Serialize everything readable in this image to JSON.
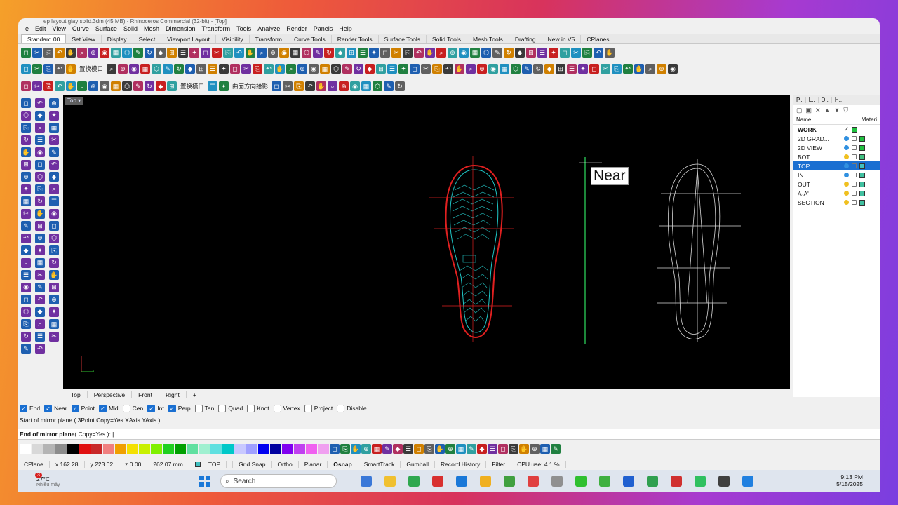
{
  "window_title": "ep layout giay solid.3dm (45 MB) - Rhinoceros Commercial (32-bit) - [Top]",
  "menu": [
    "e",
    "Edit",
    "View",
    "Curve",
    "Surface",
    "Solid",
    "Mesh",
    "Dimension",
    "Transform",
    "Tools",
    "Analyze",
    "Render",
    "Panels",
    "Help"
  ],
  "toolbar_tabs": [
    "Standard 00",
    "Set View",
    "Display",
    "Select",
    "Viewport Layout",
    "Visibility",
    "Transform",
    "Curve Tools",
    "Render Tools",
    "Surface Tools",
    "Solid Tools",
    "Mesh Tools",
    "Drafting",
    "New in V5",
    "CPlanes"
  ],
  "toolbar_text": {
    "row2_a": "置换模口",
    "row3_a": "置换模口",
    "row3_b": "曲面方向拾影"
  },
  "viewport": {
    "label": "Top",
    "tooltip": "Near"
  },
  "view_tabs": [
    "Top",
    "Perspective",
    "Front",
    "Right",
    "+"
  ],
  "osnap": [
    {
      "label": "End",
      "checked": true
    },
    {
      "label": "Near",
      "checked": true
    },
    {
      "label": "Point",
      "checked": true
    },
    {
      "label": "Mid",
      "checked": true
    },
    {
      "label": "Cen",
      "checked": false
    },
    {
      "label": "Int",
      "checked": true
    },
    {
      "label": "Perp",
      "checked": true
    },
    {
      "label": "Tan",
      "checked": false
    },
    {
      "label": "Quad",
      "checked": false
    },
    {
      "label": "Knot",
      "checked": false
    },
    {
      "label": "Vertex",
      "checked": false
    },
    {
      "label": "Project",
      "checked": false
    },
    {
      "label": "Disable",
      "checked": false
    }
  ],
  "command_history": "Start of mirror plane ( 3Point  Copy=Yes  XAxis  YAxis ):",
  "command_prompt": {
    "bold": "End of mirror plane",
    "rest": " ( Copy=Yes ): |"
  },
  "swatches": [
    "#ffffff",
    "#d8d8d8",
    "#b4b4b4",
    "#8c8c8c",
    "#000000",
    "#e01010",
    "#c82828",
    "#f08080",
    "#f0a000",
    "#f4e000",
    "#c8f000",
    "#80f000",
    "#20d020",
    "#00a000",
    "#60e0a0",
    "#a0f0d0",
    "#60e0e0",
    "#00c8c8",
    "#c8c8ff",
    "#a0a0ff",
    "#0000f0",
    "#0000a0",
    "#8000f0",
    "#c040f0",
    "#f060f0",
    "#f0a0f0"
  ],
  "status": {
    "cplane": "CPlane",
    "x": "x 162.28",
    "y": "y 223.02",
    "z": "z 0.00",
    "dist": "262.07 mm",
    "layer": "TOP",
    "items": [
      "Grid Snap",
      "Ortho",
      "Planar",
      "Osnap",
      "SmartTrack",
      "Gumball",
      "Record History",
      "Filter"
    ],
    "cpu": "CPU use: 4.1 %"
  },
  "panel": {
    "tabs": [
      "P..",
      "L..",
      "D..",
      "H.."
    ],
    "col_name": "Name",
    "col_material": "Materi",
    "layers": [
      {
        "name": "WORK",
        "bold": true,
        "current": true,
        "color": "#20c040"
      },
      {
        "name": "2D GRAD...",
        "color": "#20c040"
      },
      {
        "name": "2D VIEW",
        "color": "#20c040"
      },
      {
        "name": "BOT",
        "color": "#40c080"
      },
      {
        "name": "TOP",
        "selected": true,
        "color": "#40c0c0"
      },
      {
        "name": "IN",
        "color": "#40c0a0"
      },
      {
        "name": "OUT",
        "color": "#40c0a0"
      },
      {
        "name": "A-A'",
        "color": "#40c0a0"
      },
      {
        "name": "SECTION",
        "color": "#40c0a0"
      }
    ]
  },
  "taskbar": {
    "temp": "27°C",
    "weather": "Nhiều mây",
    "badge": "3",
    "search": "Search",
    "time": "9:13 PM",
    "date": "5/15/2025"
  }
}
